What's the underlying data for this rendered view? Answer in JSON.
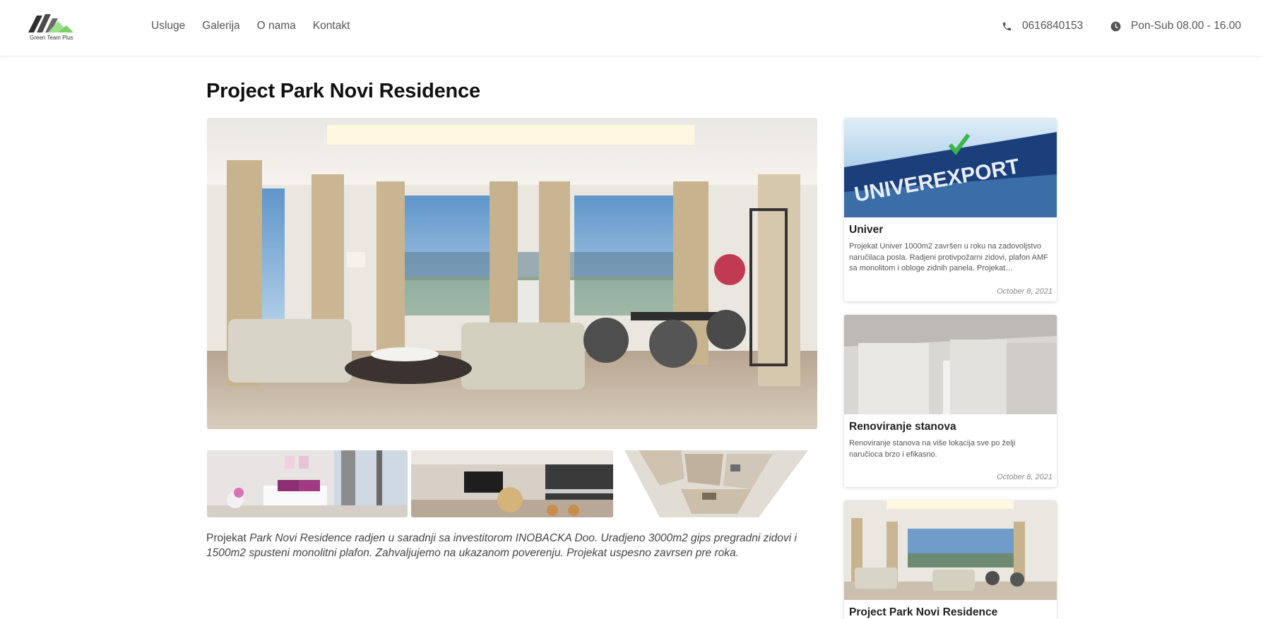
{
  "header": {
    "logo_text": "Green Team Plus",
    "nav": [
      "Usluge",
      "Galerija",
      "O nama",
      "Kontakt"
    ],
    "phone": "0616840153",
    "hours": "Pon-Sub 08.00 - 16.00"
  },
  "main": {
    "title": "Project Park Novi Residence",
    "description_lead": "Projekat ",
    "description_rest": "Park Novi Residence radjen u saradnji sa investitorom INOBACKA Doo.  Uradjeno 3000m2 gips pregradni zidovi i 1500m2 spusteni monolitni plafon. Zahvaljujemo na ukazanom poverenju. Projekat  uspesno zavrsen pre roka."
  },
  "sidebar": {
    "cards": [
      {
        "image_sign": "UNIVEREXPORT",
        "title": "Univer",
        "text": "Projekat Univer 1000m2 završen u roku na zadovoljstvo naručilaca posla. Radjeni protivpožarni zidovi, plafon AMF sa monolitom i obloge zidnih panela. Projekat…",
        "date": "October 8, 2021"
      },
      {
        "title": "Renoviranje stanova",
        "text": "Renoviranje stanova na više lokacija sve po želji naručioca brzo i efikasno.",
        "date": "October 8, 2021"
      },
      {
        "title": "Project Park Novi Residence"
      }
    ]
  },
  "colors": {
    "accent_green": "#3bb54a",
    "logo_green": "#9fe08f",
    "text_dark": "#111111",
    "nav_text": "#555555"
  },
  "icons": {
    "phone": "phone-icon",
    "clock": "clock-icon"
  }
}
